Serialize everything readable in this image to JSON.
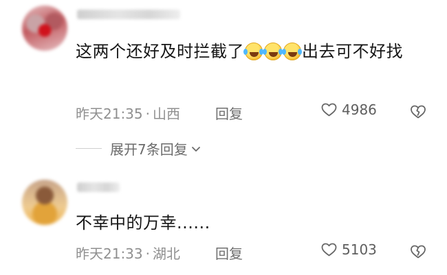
{
  "comments": [
    {
      "text_part1": "这两个还好及时拦截了",
      "emojis": [
        "laughing-crying-emoji",
        "laughing-crying-emoji",
        "laughing-crying-emoji"
      ],
      "text_part2": "出去可不好找",
      "time": "昨天21:35",
      "separator": "·",
      "location": "山西",
      "reply_label": "回复",
      "likes": "4986"
    },
    {
      "text": "不幸中的万幸......",
      "time": "昨天21:33",
      "separator": "·",
      "location": "湖北",
      "reply_label": "回复",
      "likes": "5103"
    }
  ],
  "expand_replies_label": "展开7条回复",
  "colors": {
    "meta_text": "#8f8f8f",
    "body_text": "#161616",
    "icon_stroke": "#666666"
  }
}
